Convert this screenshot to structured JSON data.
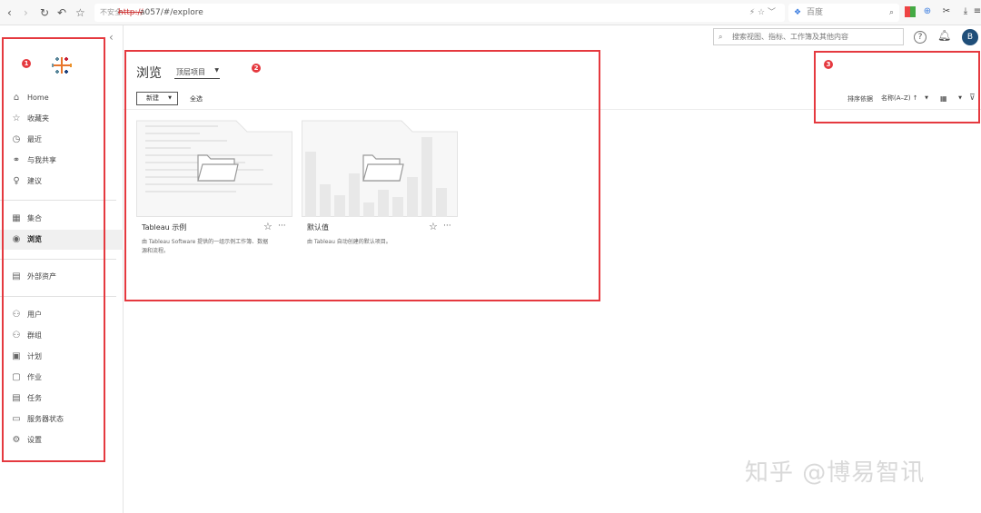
{
  "browser": {
    "url_warning": "不安全",
    "url_protocol": "http://",
    "url_rest": "a057/#/explore",
    "url_tail": "⚡ ☆ ﹀",
    "search_engine_label": "百度"
  },
  "sidebar": {
    "items_group1": [
      {
        "icon": "⌂",
        "label": "Home"
      },
      {
        "icon": "☆",
        "label": "收藏夹"
      },
      {
        "icon": "◷",
        "label": "最近"
      },
      {
        "icon": "⚭",
        "label": "与我共享"
      },
      {
        "icon": "♀",
        "label": "建议"
      }
    ],
    "items_group2": [
      {
        "icon": "▦",
        "label": "集合"
      },
      {
        "icon": "◉",
        "label": "浏览"
      }
    ],
    "items_group3": [
      {
        "icon": "▤",
        "label": "外部资产"
      }
    ],
    "items_group4": [
      {
        "icon": "⚇",
        "label": "用户"
      },
      {
        "icon": "⚇",
        "label": "群组"
      },
      {
        "icon": "▣",
        "label": "计划"
      },
      {
        "icon": "▢",
        "label": "作业"
      },
      {
        "icon": "▤",
        "label": "任务"
      },
      {
        "icon": "▭",
        "label": "服务器状态"
      },
      {
        "icon": "⚙",
        "label": "设置"
      }
    ]
  },
  "header": {
    "search_placeholder": "搜索视图、指标、工作簿及其他内容",
    "help_icon": "?",
    "avatar_initial": "B"
  },
  "main": {
    "title": "浏览",
    "filter_label": "顶层项目",
    "new_button": "新建",
    "select_all": "全选",
    "sort_label": "排序依据",
    "sort_value": "名称(A–Z) ↑",
    "cards": [
      {
        "title": "Tableau 示例",
        "desc_line1": "由 Tableau Software 提供的一组示例工作簿、数据",
        "desc_line2": "源和流程。"
      },
      {
        "title": "默认值",
        "desc_line1": "由 Tableau 自动创建的默认项目。",
        "desc_line2": ""
      }
    ]
  },
  "annotations": {
    "marker1": "1",
    "marker2": "2",
    "marker3": "3"
  },
  "watermark": "知乎 @博易智讯",
  "colors": {
    "accent_red": "#e5393f",
    "avatar_bg": "#1f4e79"
  }
}
